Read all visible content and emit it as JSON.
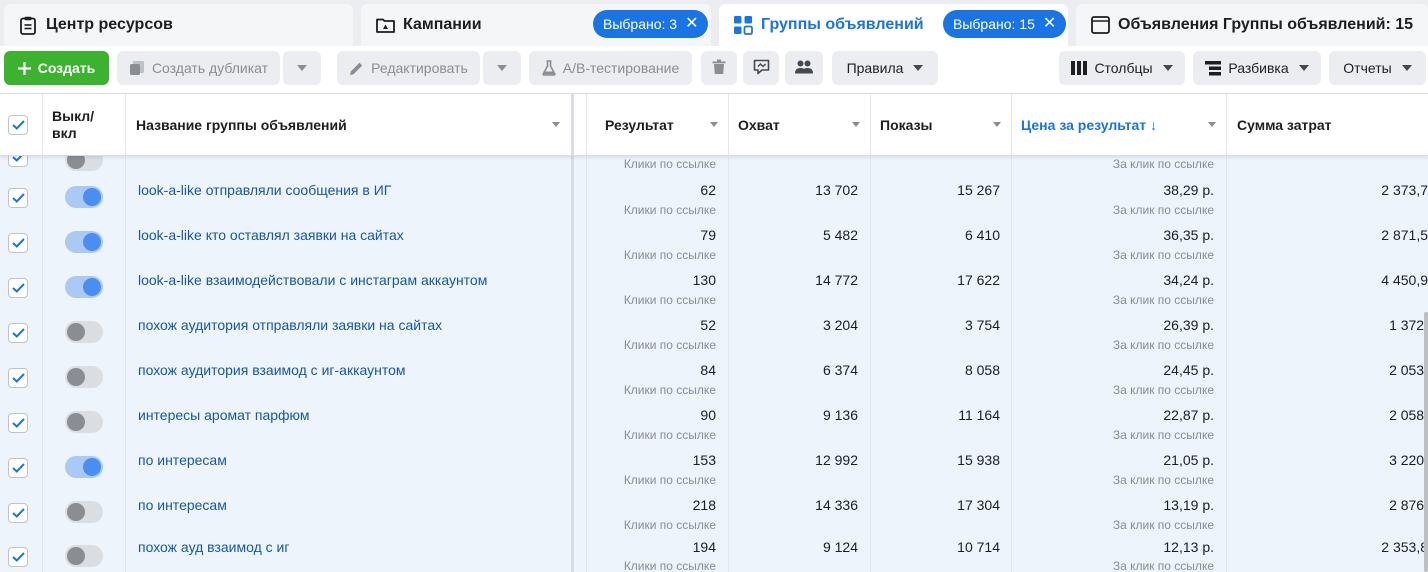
{
  "tabs": {
    "resource_center": "Центр ресурсов",
    "campaigns": "Кампании",
    "campaigns_selected": "Выбрано: 3",
    "ad_groups": "Группы объявлений",
    "ad_groups_selected": "Выбрано: 15",
    "ads": "Объявления Группы объявлений: 15"
  },
  "toolbar": {
    "create": "Создать",
    "duplicate": "Создать дубликат",
    "edit": "Редактировать",
    "ab_test": "A/B-тестирование",
    "rules": "Правила",
    "columns": "Столбцы",
    "breakdown": "Разбивка",
    "reports": "Отчеты"
  },
  "columns": {
    "toggle": "Выкл/ вкл",
    "name": "Название группы объявлений",
    "result": "Результат",
    "reach": "Охват",
    "impressions": "Показы",
    "cpr": "Цена за результат",
    "cpr_sort": "↓",
    "spend": "Сумма затрат"
  },
  "partial_row": {
    "result_sub": "Клики по ссылке",
    "cpr_sub": "За клик по ссылке"
  },
  "rows": [
    {
      "name": "look-a-like отправляли сообщения в ИГ",
      "on": true,
      "result": "62",
      "result_sub": "Клики по ссылке",
      "reach": "13 702",
      "impressions": "15 267",
      "cpr": "38,29 р.",
      "cpr_sub": "За клик по ссылке",
      "spend": "2 373,7"
    },
    {
      "name": "look-a-like кто оставлял заявки на сайтах",
      "on": true,
      "result": "79",
      "result_sub": "Клики по ссылке",
      "reach": "5 482",
      "impressions": "6 410",
      "cpr": "36,35 р.",
      "cpr_sub": "За клик по ссылке",
      "spend": "2 871,5"
    },
    {
      "name": "look-a-like взаимодействовали с инстаграм аккаунтом",
      "on": true,
      "result": "130",
      "result_sub": "Клики по ссылке",
      "reach": "14 772",
      "impressions": "17 622",
      "cpr": "34,24 р.",
      "cpr_sub": "За клик по ссылке",
      "spend": "4 450,9"
    },
    {
      "name": "похож аудитория отправляли заявки на сайтах",
      "on": false,
      "result": "52",
      "result_sub": "Клики по ссылке",
      "reach": "3 204",
      "impressions": "3 754",
      "cpr": "26,39 р.",
      "cpr_sub": "За клик по ссылке",
      "spend": "1 372,"
    },
    {
      "name": "похож аудитория взаимод с иг-аккаунтом",
      "on": false,
      "result": "84",
      "result_sub": "Клики по ссылке",
      "reach": "6 374",
      "impressions": "8 058",
      "cpr": "24,45 р.",
      "cpr_sub": "За клик по ссылке",
      "spend": "2 053,"
    },
    {
      "name": "интересы аромат парфюм",
      "on": false,
      "result": "90",
      "result_sub": "Клики по ссылке",
      "reach": "9 136",
      "impressions": "11 164",
      "cpr": "22,87 р.",
      "cpr_sub": "За клик по ссылке",
      "spend": "2 058,"
    },
    {
      "name": "по интересам",
      "on": true,
      "result": "153",
      "result_sub": "Клики по ссылке",
      "reach": "12 992",
      "impressions": "15 938",
      "cpr": "21,05 р.",
      "cpr_sub": "За клик по ссылке",
      "spend": "3 220,"
    },
    {
      "name": "по интересам",
      "on": false,
      "result": "218",
      "result_sub": "Клики по ссылке",
      "reach": "14 336",
      "impressions": "17 304",
      "cpr": "13,19 р.",
      "cpr_sub": "За клик по ссылке",
      "spend": "2 876,"
    },
    {
      "name": "похож ауд взаимод с иг",
      "on": false,
      "result": "194",
      "result_sub": "Клики по ссылке",
      "reach": "9 124",
      "impressions": "10 714",
      "cpr": "12,13 р.",
      "cpr_sub": "За клик по ссылке",
      "spend": "2 353,8"
    }
  ],
  "colors": {
    "accent": "#1b74e4",
    "create": "#3cb32f",
    "row_selected": "#eef4fc"
  }
}
